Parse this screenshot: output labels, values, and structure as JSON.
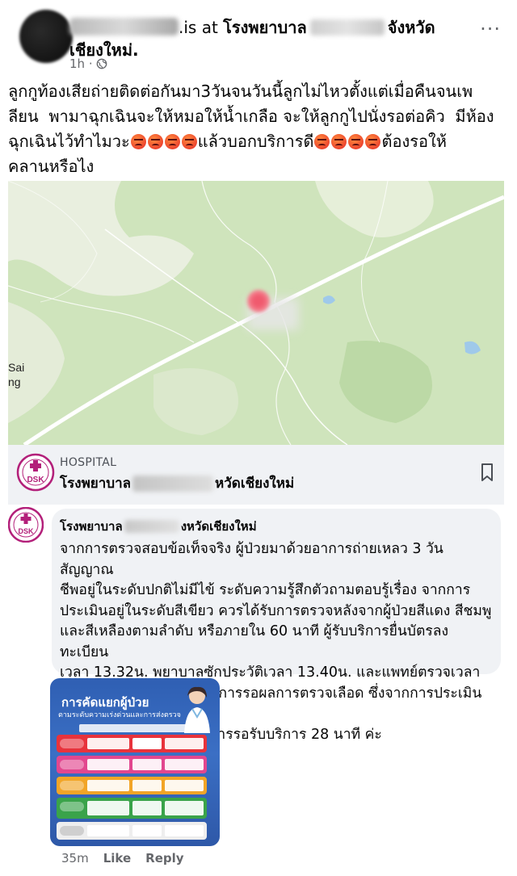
{
  "post": {
    "author_suffix": ".is at",
    "location_prefix": "โรงพยาบาล",
    "location_suffix": "จังหวัด",
    "location_line2": "เชียงใหม่.",
    "time": "1h ·",
    "more_label": "···",
    "text_line1": "ลูกกูท้องเสียถ่ายติดต่อกันมา3วันจนวันนี้ลูกไม่ไหวตั้งแต่เมื่อคืนจนเพ",
    "text_line2": "ลียน  พามาฉุกเฉินจะให้หมอให้น้ำเกลือ จะให้ลูกกูไปนั่งรอต่อคิว  มีห้อง",
    "text_line3a": "ฉุกเฉินไว้ทำไมวะ",
    "text_line3b": "แล้วบอกบริการดี",
    "text_line3c": "ต้องรอให้",
    "text_line4": "คลานหรือไง"
  },
  "map": {
    "label_line1": "Sai",
    "label_line2": "ng",
    "water_color": "#9fc9ea",
    "land_color": "#cfe4bc"
  },
  "place": {
    "category": "HOSPITAL",
    "name_prefix": "โรงพยาบาล",
    "name_suffix": "หวัดเชียงใหม่",
    "logo_text": "DSK",
    "logo_color": "#b3207a"
  },
  "comment": {
    "author_prefix": "โรงพยาบาล",
    "author_suffix": "งหวัดเชียงใหม่",
    "text": "จากการตรวจสอบข้อเท็จจริง ผู้ป่วยมาด้วยอาการถ่ายเหลว 3 วัน สัญญาณ\nชีพอยู่ในระดับปกติไม่มีไข้ ระดับความรู้สึกตัวถามตอบรู้เรื่อง จากการ\nประเมินอยู่ในระดับสีเขียว ควรได้รับการตรวจหลังจากผู้ป่วยสีแดง สีชมพู\nและสีเหลืองตามลำดับ หรือภายใน 60 นาที ผู้รับบริการยื่นบัตรลงทะเบียน\nเวลา 13.32น. พยาบาลซักประวัติเวลา 13.40น. และแพทย์ตรวจเวลา\n14.00น.ขณะนี้อยู่ระหว่างการรอผลการตรวจเลือด ซึ่งจากการประเมินและ\nตามระยะเวลาใช้เวลาในการรอรับบริการ 28 นาที ค่ะ",
    "time": "35m",
    "like_label": "Like",
    "reply_label": "Reply"
  },
  "infographic": {
    "title": "การคัดแยกผู้ป่วย",
    "subtitle": "ตามระดับความเร่งด่วนและการส่งตรวจ",
    "row_colors": [
      "#e8333c",
      "#e2478f",
      "#f2a527",
      "#3aa34a",
      "#eeeeee"
    ]
  }
}
